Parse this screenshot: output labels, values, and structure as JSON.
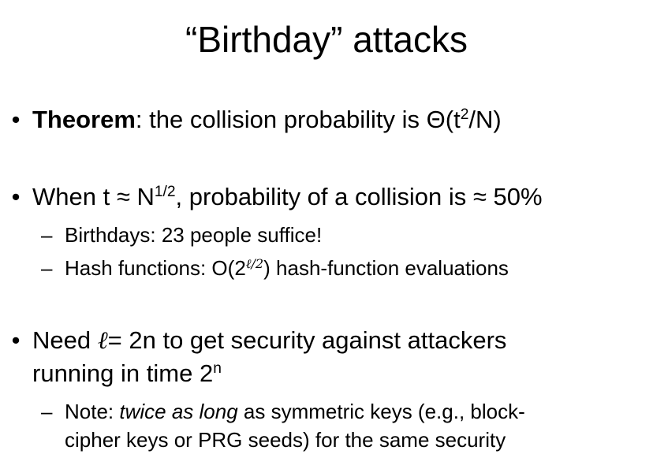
{
  "slide": {
    "title": "“Birthday” attacks",
    "bullet_marker": "•",
    "dash_marker": "–",
    "bullets": [
      {
        "bold_label": "Theorem",
        "after_label": ": the collision probability is Θ(t",
        "sup": "2",
        "end": "/N)"
      },
      {
        "pre": "When t ≈ N",
        "sup": "1/2",
        "post": ", probability of a collision is ≈ 50%",
        "subs": [
          {
            "text": "Birthdays: 23 people suffice!"
          },
          {
            "pre": "Hash functions: O(2",
            "sup": "ℓ/2",
            "post": ") hash-function evaluations"
          }
        ]
      },
      {
        "pre": "Need ",
        "ell": "ℓ",
        "post": "= 2n to get security against attackers",
        "line2_pre": "running in time 2",
        "line2_sup": "n",
        "subs": [
          {
            "pre": "Note: ",
            "italic": "twice as long",
            "post": " as symmetric keys (e.g., block-",
            "line2": "cipher keys or PRG seeds) for the same security"
          }
        ]
      }
    ]
  }
}
